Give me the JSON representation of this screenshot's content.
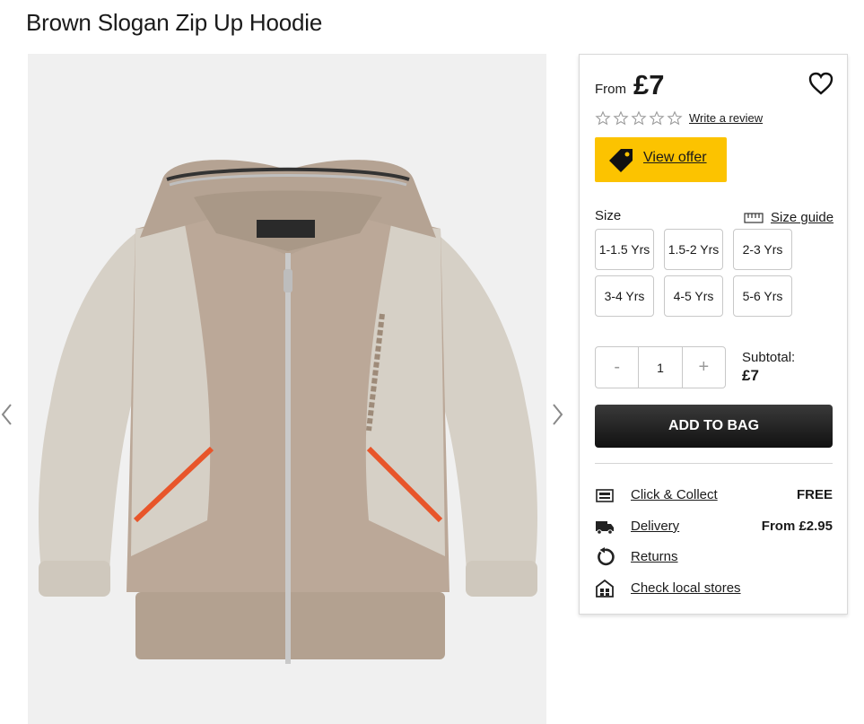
{
  "product": {
    "title": "Brown Slogan Zip Up Hoodie",
    "price_prefix": "From",
    "price": "£7",
    "rating": 0,
    "review_link": "Write a review",
    "image_icon": "hoodie-product-image"
  },
  "offer": {
    "label": "View offer",
    "icon": "price-tag-icon",
    "color": "#fcc300"
  },
  "size": {
    "label": "Size",
    "guide_label": "Size guide",
    "options": [
      "1-1.5 Yrs",
      "1.5-2 Yrs",
      "2-3 Yrs",
      "3-4 Yrs",
      "4-5 Yrs",
      "5-6 Yrs"
    ]
  },
  "quantity": {
    "minus": "-",
    "value": "1",
    "plus": "+"
  },
  "subtotal": {
    "label": "Subtotal:",
    "value": "£7"
  },
  "add_to_bag": "ADD TO BAG",
  "services": [
    {
      "label": "Click & Collect",
      "value": "FREE",
      "icon": "click-collect-icon"
    },
    {
      "label": "Delivery",
      "value": "From £2.95",
      "icon": "delivery-truck-icon"
    },
    {
      "label": "Returns",
      "value": "",
      "icon": "returns-icon"
    },
    {
      "label": "Check local stores",
      "value": "",
      "icon": "store-icon"
    }
  ]
}
